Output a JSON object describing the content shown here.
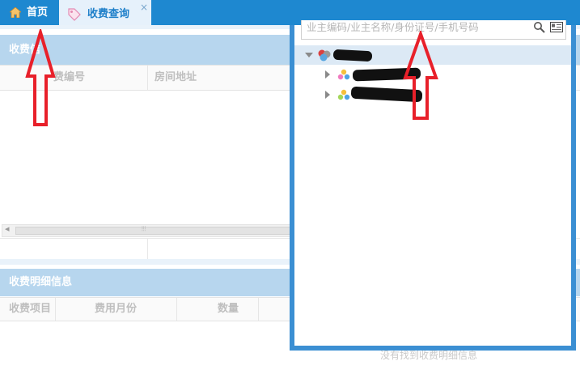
{
  "tabs": {
    "home_label": "首页",
    "query_label": "收费查询",
    "close_glyph": "×"
  },
  "charge_panel": {
    "title": "收费信",
    "columns": [
      "费编号",
      "房间地址"
    ],
    "scroll_left": "◂",
    "scroll_grip": "⦙⦙⦙"
  },
  "detail_panel": {
    "title": "收费明细信息",
    "columns": [
      "收费项目",
      "费用月份",
      "数量"
    ],
    "empty_text": "没有找到收费明细信息"
  },
  "dropdown": {
    "search_placeholder": "业主编码/业主名称/身份证号/手机号码",
    "tree": [
      {
        "label": "",
        "level": 0,
        "expanded": true
      },
      {
        "label": "",
        "level": 1,
        "expanded": false
      },
      {
        "label": "",
        "level": 1,
        "expanded": false
      }
    ]
  },
  "colors": {
    "tabbar": "#1e88d0",
    "panel_header": "#b7d6ee",
    "dropdown_border": "#3b8fd3",
    "annotation": "#e8202a"
  },
  "icons": [
    "home-icon",
    "tag-icon",
    "close-icon",
    "search-icon",
    "address-book-icon",
    "tree-root-icon",
    "tree-node-icon",
    "arrow-up-annotation"
  ]
}
